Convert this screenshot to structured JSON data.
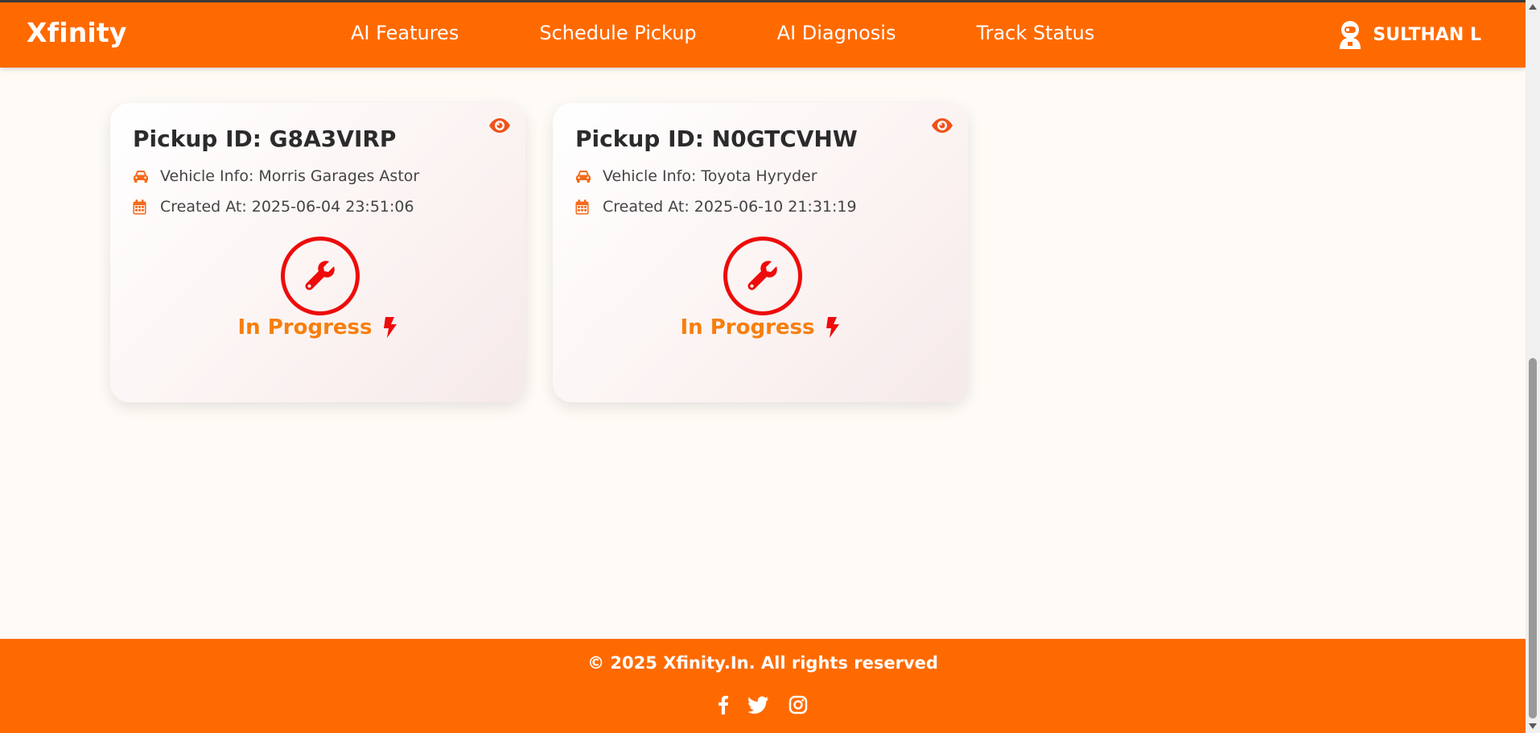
{
  "navbar": {
    "brand": "Xfinity",
    "links": [
      "AI Features",
      "Schedule Pickup",
      "AI Diagnosis",
      "Track Status"
    ],
    "user_name": "SULTHAN L",
    "user_icon": "astronaut-icon"
  },
  "cards": [
    {
      "pickup_id": "Pickup ID: G8A3VIRP",
      "vehicle_info": "Vehicle Info: Morris Garages Astor",
      "created_at": "Created At: 2025-06-04 23:51:06",
      "status": "In Progress"
    },
    {
      "pickup_id": "Pickup ID: N0GTCVHW",
      "vehicle_info": "Vehicle Info: Toyota Hyryder",
      "created_at": "Created At: 2025-06-10 21:31:19",
      "status": "In Progress"
    }
  ],
  "footer": {
    "copyright": "© 2025 Xfinity.In. All rights reserved",
    "socials": [
      "facebook-icon",
      "twitter-icon",
      "instagram-icon"
    ]
  },
  "colors": {
    "brand_orange": "#ff6a00",
    "status_orange": "#f77f0c",
    "status_red": "#ee0b0b",
    "icon_orange": "#f46a1a"
  }
}
